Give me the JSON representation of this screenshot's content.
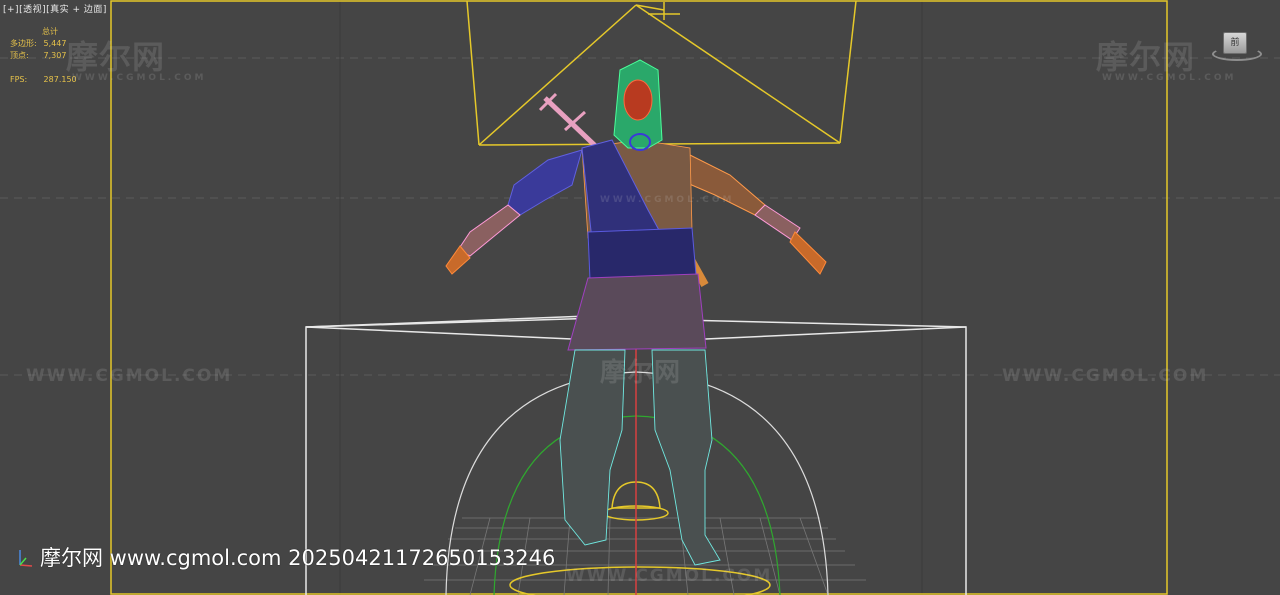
{
  "viewport": {
    "label_parts": [
      "[+]",
      "[透视]",
      "[真实 + 边面]"
    ]
  },
  "stats": {
    "total_label": "总计",
    "polygons_label": "多边形:",
    "polygons_value": "5,447",
    "vertices_label": "顶点:",
    "vertices_value": "7,307",
    "fps_label": "FPS:",
    "fps_value": "287.150"
  },
  "viewcube": {
    "face_label": "前"
  },
  "watermarks": {
    "brand_cn": "摩尔网",
    "brand_url": "WWW.CGMOL.COM",
    "footer": "摩尔网 www.cgmol.com 20250421172650153246"
  },
  "colors": {
    "viewport_bg": "#454545",
    "selection_yellow": "#e5c82a",
    "bounding_white": "#e8e8e8",
    "grid": "#6a6a6a",
    "stats_text": "#e6c24a"
  },
  "icons": {
    "axis_gizmo": "axis-tripod-icon",
    "viewcube": "viewcube-icon"
  }
}
